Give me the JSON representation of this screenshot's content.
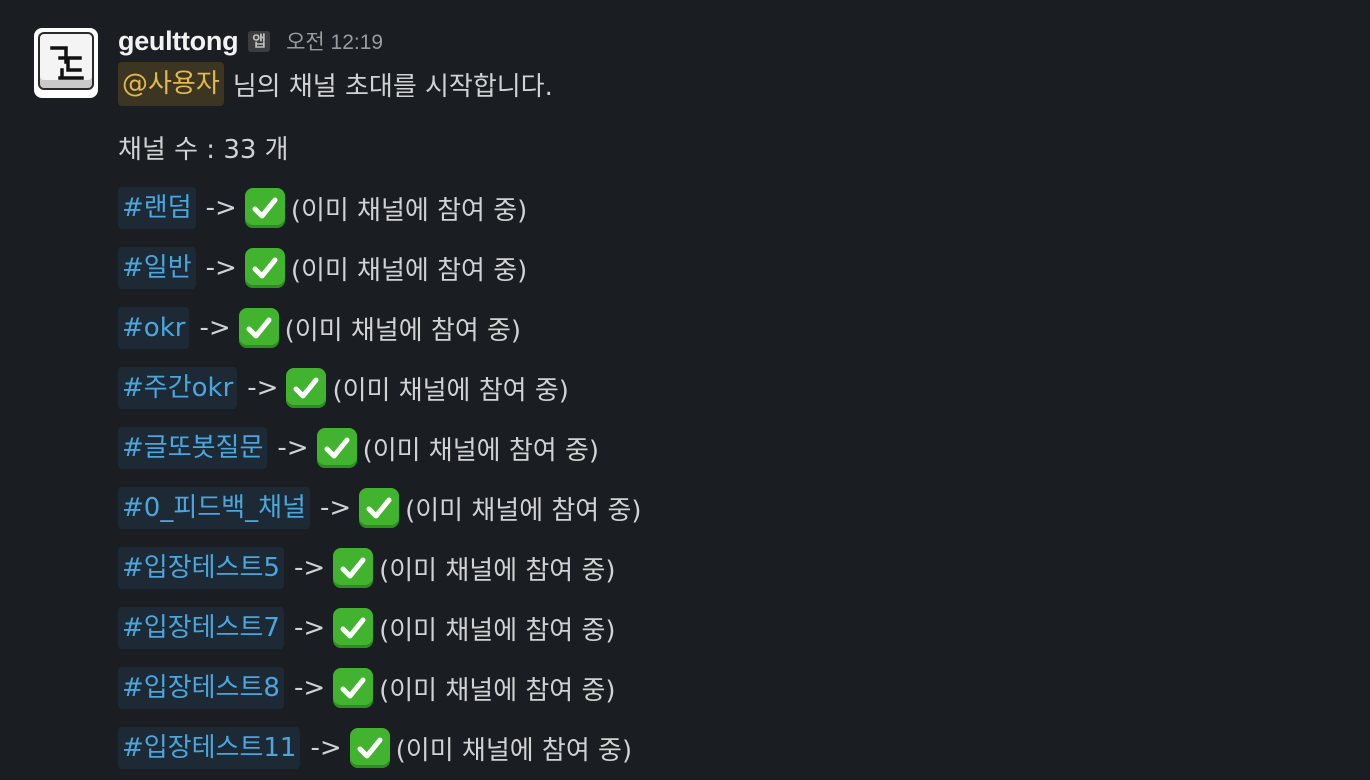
{
  "message": {
    "sender": "geulttong",
    "badge": "앱",
    "time": "오전 12:19",
    "mention": "@사용자",
    "intro": "님의 채널 초대를 시작합니다.",
    "count_line": "채널 수 : 33 개",
    "arrow": "->",
    "icon": "check-mark-button-icon",
    "rows": [
      {
        "channel": "#랜덤",
        "status": "(이미 채널에 참여 중)"
      },
      {
        "channel": "#일반",
        "status": "(이미 채널에 참여 중)"
      },
      {
        "channel": "#okr",
        "status": "(이미 채널에 참여 중)"
      },
      {
        "channel": "#주간okr",
        "status": "(이미 채널에 참여 중)"
      },
      {
        "channel": "#글또봇질문",
        "status": "(이미 채널에 참여 중)"
      },
      {
        "channel": "#0_피드백_채널",
        "status": "(이미 채널에 참여 중)"
      },
      {
        "channel": "#입장테스트5",
        "status": "(이미 채널에 참여 중)"
      },
      {
        "channel": "#입장테스트7",
        "status": "(이미 채널에 참여 중)"
      },
      {
        "channel": "#입장테스트8",
        "status": "(이미 채널에 참여 중)"
      },
      {
        "channel": "#입장테스트11",
        "status": "(이미 채널에 참여 중)"
      }
    ]
  },
  "colors": {
    "background": "#1a1d21",
    "text": "#d1d2d3",
    "mention": "#e3b84e",
    "channel_link": "#4aa6dd",
    "check": "#42b32e"
  }
}
